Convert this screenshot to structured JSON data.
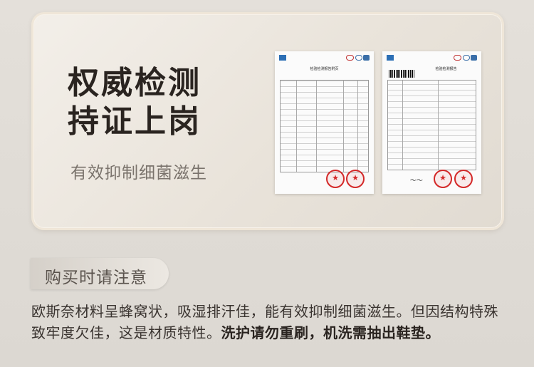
{
  "heading": {
    "line1": "权威检测",
    "line2": "持证上岗",
    "subtitle": "有效抑制细菌滋生"
  },
  "notice": {
    "tag_label": "购买时请注意",
    "text_part1": "欧斯奈材料呈蜂窝状，吸湿排汗佳，能有效抑制细菌滋生。但因结构特殊致牢度欠佳，这是材质特性。",
    "text_bold": "洗护请勿重刷，机洗需抽出鞋垫。"
  },
  "certificates": [
    {
      "title": "检验检测报告附页"
    },
    {
      "title": "检验检测报告"
    }
  ],
  "colors": {
    "stamp": "#d42a2a",
    "heading": "#2a2420",
    "subtitle": "#7a736c"
  }
}
